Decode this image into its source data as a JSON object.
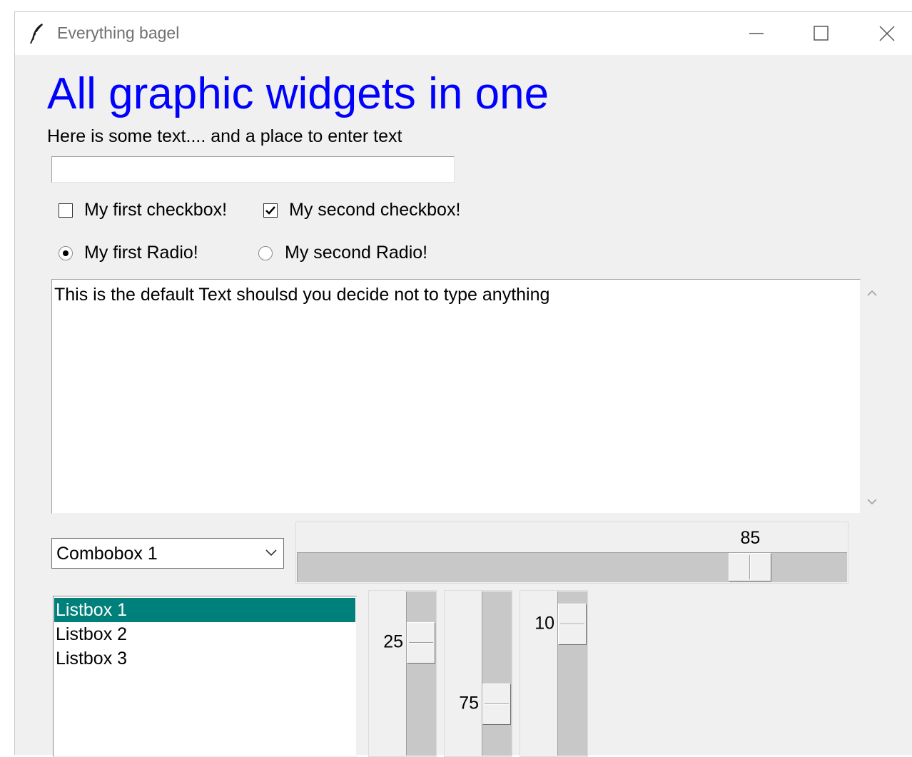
{
  "window": {
    "title": "Everything bagel",
    "icon": "feather-icon",
    "controls": [
      "minimize-icon",
      "maximize-icon",
      "close-icon"
    ]
  },
  "heading": "All graphic widgets in one",
  "subtext": "Here is some text.... and a place to enter text",
  "entry": {
    "value": "",
    "placeholder": ""
  },
  "checkboxes": [
    {
      "label": "My first checkbox!",
      "checked": false
    },
    {
      "label": "My second checkbox!",
      "checked": true
    }
  ],
  "radios": [
    {
      "label": "My first Radio!",
      "selected": true
    },
    {
      "label": "My second Radio!",
      "selected": false
    }
  ],
  "textarea": {
    "value": "This is the default Text shoulsd you decide not to type anything"
  },
  "combobox": {
    "value": "Combobox 1"
  },
  "hscale": {
    "value": "85",
    "min": 0,
    "max": 100
  },
  "listbox": {
    "items": [
      "Listbox 1",
      "Listbox 2",
      "Listbox 3"
    ],
    "selected_index": 0
  },
  "vscales": [
    {
      "value": "25",
      "min": 0,
      "max": 100
    },
    {
      "value": "75",
      "min": 0,
      "max": 100
    },
    {
      "value": "10",
      "min": 0,
      "max": 100
    }
  ],
  "colors": {
    "heading": "#0000ff",
    "selection": "#00807a",
    "window_bg": "#f0f0f0"
  }
}
